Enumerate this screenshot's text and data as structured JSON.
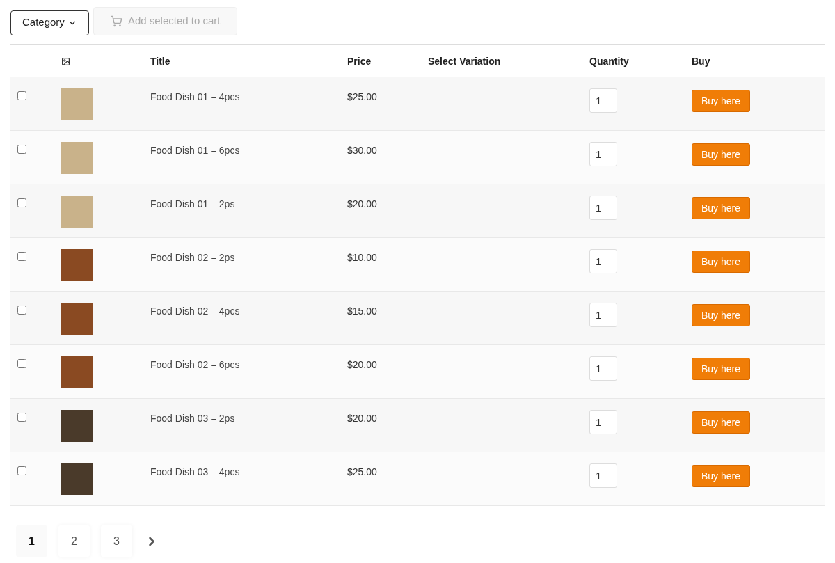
{
  "toolbar": {
    "category_button": "Category",
    "add_to_cart_button": {
      "label": "Add selected to cart",
      "disabled": true
    }
  },
  "table": {
    "columns": [
      "Title",
      "Price",
      "Select Variation",
      "Quantity",
      "Buy"
    ],
    "rows": [
      {
        "checked": false,
        "title": "Food Dish 01 – 4pcs",
        "price": "$25.00",
        "quantity": "1",
        "buy": "Buy here"
      },
      {
        "checked": false,
        "title": "Food Dish 01 – 6pcs",
        "price": "$30.00",
        "quantity": "1",
        "buy": "Buy here"
      },
      {
        "checked": false,
        "title": "Food Dish 01 – 2ps",
        "price": "$20.00",
        "quantity": "1",
        "buy": "Buy here"
      },
      {
        "checked": false,
        "title": "Food Dish 02 – 2ps",
        "price": "$10.00",
        "quantity": "1",
        "buy": "Buy here"
      },
      {
        "checked": false,
        "title": "Food Dish 02 – 4pcs",
        "price": "$15.00",
        "quantity": "1",
        "buy": "Buy here"
      },
      {
        "checked": false,
        "title": "Food Dish 02 – 6pcs",
        "price": "$20.00",
        "quantity": "1",
        "buy": "Buy here"
      },
      {
        "checked": false,
        "title": "Food Dish 03 – 2ps",
        "price": "$20.00",
        "quantity": "1",
        "buy": "Buy here"
      },
      {
        "checked": false,
        "title": "Food Dish 03 – 4pcs",
        "price": "$25.00",
        "quantity": "1",
        "buy": "Buy here"
      }
    ]
  },
  "pagination": {
    "pages": [
      {
        "label": "1",
        "selected": true
      },
      {
        "label": "2",
        "selected": false
      },
      {
        "label": "3",
        "selected": false
      }
    ]
  }
}
